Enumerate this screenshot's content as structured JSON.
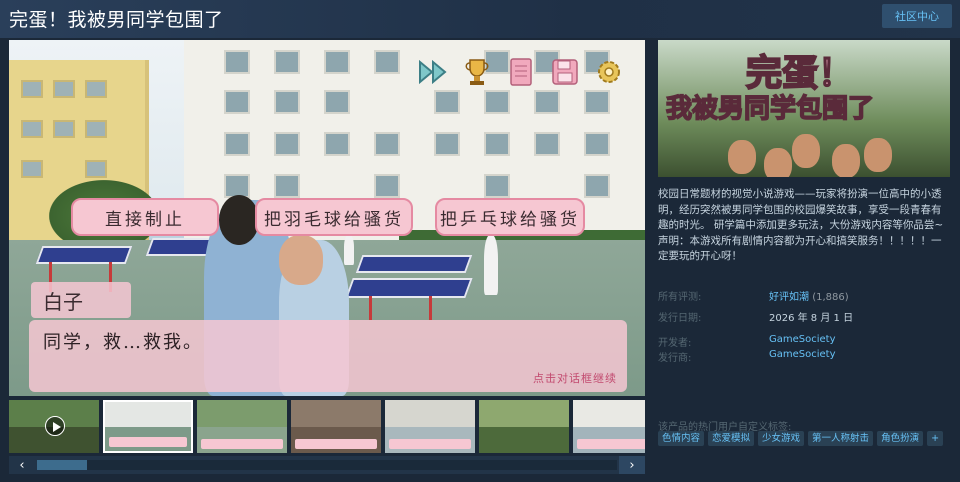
{
  "header": {
    "title": "完蛋！我被男同学包围了",
    "community_hub": "社区中心"
  },
  "screenshot": {
    "choices": [
      "直接制止",
      "把羽毛球给骚货",
      "把乒乓球给骚货"
    ],
    "speaker": "白子",
    "dialog": "同学，救…救我。",
    "hint": "点击对话框继续",
    "icons": [
      "fast-forward-icon",
      "trophy-icon",
      "notebook-icon",
      "save-icon",
      "settings-gear-icon"
    ]
  },
  "capsule": {
    "line1": "完蛋！",
    "line2": "我被男同学包围了"
  },
  "description": "校园日常题材的视觉小说游戏——玩家将扮演一位高中的小透明，经历突然被男同学包围的校园爆笑故事，享受一段青春有趣的时光。 研学篇中添加更多玩法，大份游戏内容等你品尝~ 声明：本游戏所有剧情内容都为开心和搞笑服务！！！！！一定要玩的开心呀！",
  "meta": {
    "reviews_label": "所有评测:",
    "reviews_value": "好评如潮",
    "reviews_count": "(1,886)",
    "release_label": "发行日期:",
    "release_value": "2026 年 8 月 1 日",
    "developer_label": "开发者:",
    "developer_value": "GameSociety",
    "publisher_label": "发行商:",
    "publisher_value": "GameSociety"
  },
  "tags": {
    "label": "该产品的热门用户自定义标签:",
    "items": [
      "色情内容",
      "恋爱模拟",
      "少女游戏",
      "第一人称射击",
      "角色扮演",
      "+"
    ]
  },
  "colors": {
    "background": "#1b2838",
    "accent": "#66c0f4",
    "pink": "#f6c7d2"
  }
}
